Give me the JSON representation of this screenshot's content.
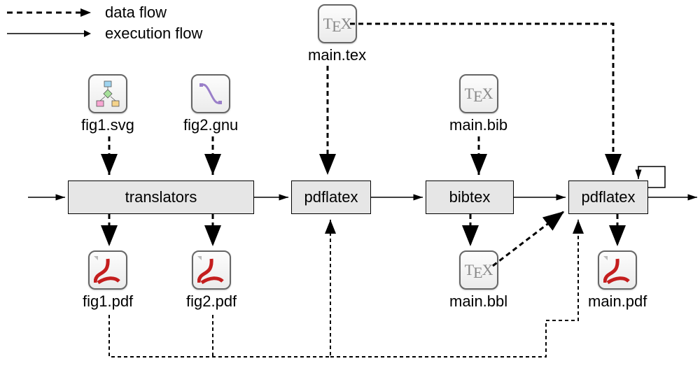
{
  "legend": {
    "data_flow": "data flow",
    "execution_flow": "execution flow"
  },
  "files": {
    "main_tex": "main.tex",
    "fig1_svg": "fig1.svg",
    "fig2_gnu": "fig2.gnu",
    "main_bib": "main.bib",
    "fig1_pdf": "fig1.pdf",
    "fig2_pdf": "fig2.pdf",
    "main_bbl": "main.bbl",
    "main_pdf": "main.pdf"
  },
  "processes": {
    "translators": "translators",
    "pdflatex1": "pdflatex",
    "bibtex": "bibtex",
    "pdflatex2": "pdflatex"
  }
}
